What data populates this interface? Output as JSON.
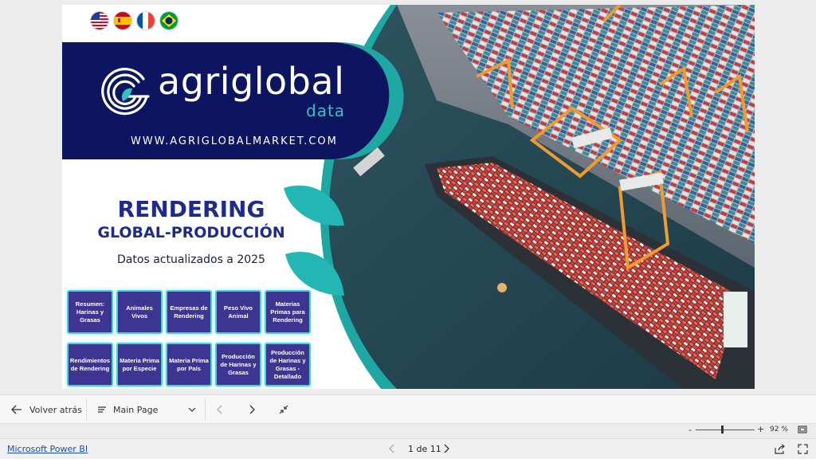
{
  "report": {
    "flags": [
      {
        "country": "united-states",
        "icon": "us-flag-icon"
      },
      {
        "country": "spain",
        "icon": "spain-flag-icon"
      },
      {
        "country": "france",
        "icon": "france-flag-icon"
      },
      {
        "country": "brazil",
        "icon": "brazil-flag-icon"
      }
    ],
    "brand": {
      "name": "agriglobal",
      "sub": "data",
      "url": "WWW.AGRIGLOBALMARKET.COM"
    },
    "title": {
      "main": "RENDERING",
      "sub": "GLOBAL-PRODUCCIÓN",
      "updated": "Datos actualizados a 2025"
    },
    "nav_buttons": [
      "Resumen: Harinas y Grasas",
      "Animales Vivos",
      "Empresas de Rendering",
      "Peso Vivo Animal",
      "Materias Primas para Rendering",
      "Rendimientos de Rendering",
      "Materia Prima por Especie",
      "Materia Prima por País",
      "Producción de Harinas y Grasas",
      "Producción de Harinas y Grasas - Detallado"
    ]
  },
  "navbar": {
    "back_label": "Volver atrás",
    "page_select": "Main Page"
  },
  "zoom": {
    "minus": "-",
    "plus": "+",
    "level_label": "92 %",
    "level_percent": 92
  },
  "footer": {
    "brand_link": "Microsoft Power BI",
    "pager": "1 de 11"
  },
  "colors": {
    "navy": "#0e1560",
    "teal": "#2ec4c6",
    "title_blue": "#1e2a8e",
    "button_fill": "#3e3593",
    "button_border": "#46d2d4"
  }
}
